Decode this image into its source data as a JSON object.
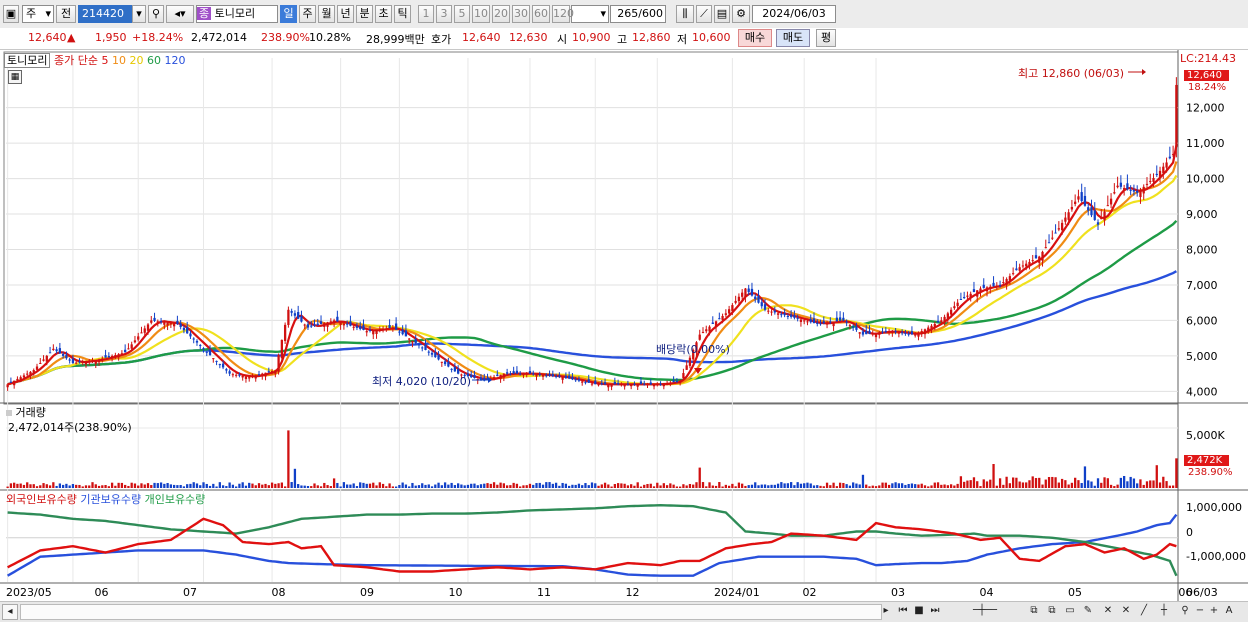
{
  "toolbar": {
    "market": "주",
    "prev": "전",
    "code": "214420",
    "name_badge": "종",
    "name": "토니모리",
    "periods": [
      "일",
      "주",
      "월",
      "년",
      "분",
      "초",
      "틱"
    ],
    "intervals": [
      "1",
      "3",
      "5",
      "10",
      "20",
      "30",
      "60",
      "120"
    ],
    "count": "265",
    "count_max": "/600",
    "date": "2024/06/03"
  },
  "quote": {
    "price": "12,640",
    "change_arrow": "▲",
    "change": "1,950",
    "change_pct": "+18.24%",
    "volume": "2,472,014",
    "volume_ratio": "238.90%",
    "turnover": "10.28%",
    "amount": "28,999백만",
    "hoga_label": "호가",
    "ask": "12,640",
    "bid": "12,630",
    "open_label": "시",
    "open": "10,900",
    "high_label": "고",
    "high": "12,860",
    "low_label": "저",
    "low": "10,600",
    "buy": "매수",
    "sell": "매도",
    "avg": "평"
  },
  "legend": {
    "name": "토니모리",
    "close": "종가",
    "simple": "단순",
    "ma": [
      "5",
      "10",
      "20",
      "60",
      "120"
    ],
    "ma_colors": [
      "#d81010",
      "#f08c14",
      "#f0e11e",
      "#1e9b46",
      "#2850dc"
    ]
  },
  "annotations": {
    "lc": "LC:214.43",
    "price_tag": "12,640",
    "pct_tag": "18.24%",
    "high_note": "최고 12,860 (06/03)",
    "low_note": "최저 4,020 (10/20)",
    "dividend": "배당락(0.00%)"
  },
  "volume_panel": {
    "title": "거래량",
    "value": "2,472,014주(238.90%)",
    "tag": "2,472K",
    "tag_pct": "238.90%",
    "axis": "5,000K"
  },
  "holdings_panel": {
    "series": [
      "외국인보유수량",
      "기관보유수량",
      "개인보유수량"
    ],
    "axis": [
      "1,000,000",
      "0",
      "-1,000,000"
    ]
  },
  "x_labels": [
    "2023/05",
    "06",
    "07",
    "08",
    "09",
    "10",
    "11",
    "12",
    "2024/01",
    "02",
    "03",
    "04",
    "05",
    "06",
    "06/03"
  ],
  "chart_data": {
    "type": "candlestick",
    "price_axis": [
      "12,000",
      "11,000",
      "10,000",
      "9,000",
      "8,000",
      "7,000",
      "6,000",
      "5,000",
      "4,000"
    ],
    "ylim": [
      3700,
      13400
    ],
    "close_keypoints": [
      [
        0,
        4200
      ],
      [
        8,
        4600
      ],
      [
        14,
        5200
      ],
      [
        20,
        4800
      ],
      [
        28,
        4900
      ],
      [
        36,
        5100
      ],
      [
        44,
        6000
      ],
      [
        52,
        5900
      ],
      [
        60,
        5200
      ],
      [
        68,
        4500
      ],
      [
        74,
        4400
      ],
      [
        82,
        4600
      ],
      [
        86,
        6300
      ],
      [
        92,
        5800
      ],
      [
        100,
        6000
      ],
      [
        110,
        5700
      ],
      [
        118,
        5800
      ],
      [
        126,
        5300
      ],
      [
        132,
        4900
      ],
      [
        138,
        4500
      ],
      [
        146,
        4300
      ],
      [
        152,
        4500
      ],
      [
        160,
        4500
      ],
      [
        170,
        4400
      ],
      [
        180,
        4200
      ],
      [
        190,
        4200
      ],
      [
        200,
        4200
      ],
      [
        206,
        4300
      ],
      [
        212,
        5600
      ],
      [
        220,
        6200
      ],
      [
        226,
        6900
      ],
      [
        232,
        6300
      ],
      [
        240,
        6100
      ],
      [
        248,
        5900
      ],
      [
        256,
        6000
      ],
      [
        262,
        5600
      ],
      [
        270,
        5700
      ],
      [
        278,
        5600
      ],
      [
        286,
        6000
      ],
      [
        292,
        6600
      ],
      [
        298,
        6900
      ],
      [
        304,
        7000
      ],
      [
        310,
        7500
      ],
      [
        316,
        7800
      ],
      [
        322,
        8600
      ],
      [
        328,
        9500
      ],
      [
        334,
        8700
      ],
      [
        340,
        9800
      ],
      [
        346,
        9600
      ],
      [
        352,
        10100
      ],
      [
        357,
        10690
      ],
      [
        358,
        12640
      ]
    ],
    "volume_spikes": [
      [
        86,
        4800
      ],
      [
        88,
        1600
      ],
      [
        100,
        800
      ],
      [
        212,
        1700
      ],
      [
        262,
        1100
      ],
      [
        302,
        2000
      ],
      [
        330,
        1800
      ],
      [
        342,
        1000
      ],
      [
        352,
        1900
      ],
      [
        358,
        2472
      ]
    ],
    "volume_max": 6000,
    "foreign": [
      [
        0,
        -1400
      ],
      [
        10,
        -600
      ],
      [
        20,
        -400
      ],
      [
        30,
        -700
      ],
      [
        40,
        -300
      ],
      [
        50,
        -100
      ],
      [
        60,
        900
      ],
      [
        66,
        600
      ],
      [
        72,
        -200
      ],
      [
        80,
        -300
      ],
      [
        86,
        -200
      ],
      [
        90,
        -500
      ],
      [
        96,
        -400
      ],
      [
        100,
        -1300
      ],
      [
        110,
        -1400
      ],
      [
        120,
        -1600
      ],
      [
        130,
        -1600
      ],
      [
        140,
        -1500
      ],
      [
        150,
        -1400
      ],
      [
        160,
        -1500
      ],
      [
        170,
        -1400
      ],
      [
        180,
        -1500
      ],
      [
        190,
        -1200
      ],
      [
        200,
        -1300
      ],
      [
        206,
        -1100
      ],
      [
        212,
        -1100
      ],
      [
        220,
        -500
      ],
      [
        228,
        -300
      ],
      [
        234,
        -200
      ],
      [
        240,
        200
      ],
      [
        250,
        100
      ],
      [
        260,
        -100
      ],
      [
        266,
        700
      ],
      [
        272,
        500
      ],
      [
        280,
        400
      ],
      [
        290,
        200
      ],
      [
        298,
        -100
      ],
      [
        304,
        0
      ],
      [
        310,
        -1000
      ],
      [
        316,
        -1100
      ],
      [
        324,
        -400
      ],
      [
        330,
        -300
      ],
      [
        336,
        -700
      ],
      [
        342,
        -500
      ],
      [
        348,
        -1000
      ],
      [
        352,
        -800
      ],
      [
        356,
        -300
      ],
      [
        358,
        -400
      ]
    ],
    "institution": [
      [
        0,
        -1800
      ],
      [
        10,
        -900
      ],
      [
        20,
        -800
      ],
      [
        30,
        -700
      ],
      [
        40,
        -600
      ],
      [
        50,
        -600
      ],
      [
        60,
        -600
      ],
      [
        70,
        -800
      ],
      [
        80,
        -1100
      ],
      [
        86,
        -1200
      ],
      [
        96,
        -1250
      ],
      [
        110,
        -1300
      ],
      [
        130,
        -1320
      ],
      [
        150,
        -1340
      ],
      [
        170,
        -1350
      ],
      [
        180,
        -1500
      ],
      [
        190,
        -1750
      ],
      [
        200,
        -1800
      ],
      [
        210,
        -1800
      ],
      [
        218,
        -1200
      ],
      [
        230,
        -900
      ],
      [
        240,
        -900
      ],
      [
        250,
        -900
      ],
      [
        260,
        -1000
      ],
      [
        266,
        -1300
      ],
      [
        272,
        -1250
      ],
      [
        280,
        -1200
      ],
      [
        286,
        -1200
      ],
      [
        294,
        -1100
      ],
      [
        300,
        -800
      ],
      [
        310,
        -500
      ],
      [
        320,
        -300
      ],
      [
        330,
        -200
      ],
      [
        340,
        100
      ],
      [
        346,
        300
      ],
      [
        352,
        600
      ],
      [
        356,
        700
      ],
      [
        358,
        1100
      ]
    ],
    "individual": [
      [
        0,
        1200
      ],
      [
        10,
        1100
      ],
      [
        20,
        900
      ],
      [
        30,
        800
      ],
      [
        40,
        600
      ],
      [
        50,
        400
      ],
      [
        60,
        300
      ],
      [
        70,
        200
      ],
      [
        80,
        500
      ],
      [
        90,
        900
      ],
      [
        100,
        1000
      ],
      [
        110,
        1100
      ],
      [
        120,
        1100
      ],
      [
        130,
        1150
      ],
      [
        140,
        1150
      ],
      [
        150,
        1200
      ],
      [
        160,
        1300
      ],
      [
        170,
        1350
      ],
      [
        180,
        1400
      ],
      [
        190,
        1500
      ],
      [
        200,
        1550
      ],
      [
        210,
        1500
      ],
      [
        220,
        1200
      ],
      [
        226,
        300
      ],
      [
        234,
        200
      ],
      [
        240,
        100
      ],
      [
        250,
        100
      ],
      [
        260,
        300
      ],
      [
        266,
        300
      ],
      [
        272,
        200
      ],
      [
        280,
        100
      ],
      [
        290,
        150
      ],
      [
        296,
        200
      ],
      [
        300,
        100
      ],
      [
        310,
        100
      ],
      [
        320,
        0
      ],
      [
        330,
        -200
      ],
      [
        340,
        -500
      ],
      [
        350,
        -800
      ],
      [
        356,
        -1100
      ],
      [
        358,
        -1800
      ]
    ],
    "holdings_ylim": [
      -2100,
      1700
    ],
    "n_days": 359
  }
}
